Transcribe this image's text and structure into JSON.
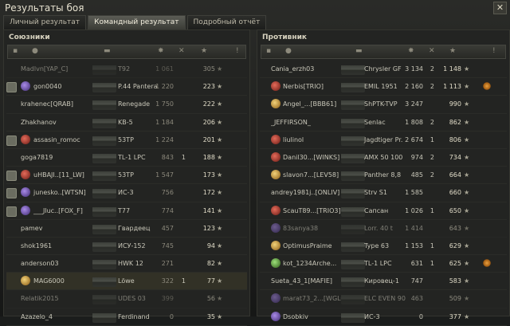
{
  "window": {
    "title": "Результаты боя",
    "close_label": "✕"
  },
  "tabs": [
    {
      "label": "Личный результат"
    },
    {
      "label": "Командный результат"
    },
    {
      "label": "Подробный отчёт"
    }
  ],
  "allies": {
    "header": "Союзники",
    "rows": [
      {
        "name": "Madlvn[YAP_C]",
        "tank": "T92",
        "damage": "1 061",
        "frags": "",
        "xp": "305",
        "dead": true
      },
      {
        "name": "gon0040",
        "tank": "P.44 Pantera",
        "damage": "1 220",
        "frags": "",
        "xp": "223",
        "dead": false
      },
      {
        "name": "krahenec[QRAB]",
        "tank": "Renegade",
        "damage": "1 750",
        "frags": "",
        "xp": "222",
        "dead": false
      },
      {
        "name": "Zhakhanov",
        "tank": "KB-5",
        "damage": "1 184",
        "frags": "",
        "xp": "206",
        "dead": false
      },
      {
        "name": "assasin_romoc",
        "tank": "53TP",
        "damage": "1 224",
        "frags": "",
        "xp": "201",
        "dead": false
      },
      {
        "name": "goga7819",
        "tank": "TL-1 LPC",
        "damage": "843",
        "frags": "1",
        "xp": "188",
        "dead": false
      },
      {
        "name": "uHBAJI..[11_LW]",
        "tank": "53TP",
        "damage": "1 547",
        "frags": "",
        "xp": "173",
        "dead": false
      },
      {
        "name": "junesko..[WTSN]",
        "tank": "ИС-3",
        "damage": "756",
        "frags": "",
        "xp": "172",
        "dead": false
      },
      {
        "name": "___Jluc..[FOX_F]",
        "tank": "T77",
        "damage": "774",
        "frags": "",
        "xp": "141",
        "dead": false
      },
      {
        "name": "pamev",
        "tank": "Гвардеец",
        "damage": "457",
        "frags": "",
        "xp": "123",
        "dead": false
      },
      {
        "name": "shok1961",
        "tank": "ИСУ-152",
        "damage": "745",
        "frags": "",
        "xp": "94",
        "dead": false
      },
      {
        "name": "anderson03",
        "tank": "HWK 12",
        "damage": "271",
        "frags": "",
        "xp": "82",
        "dead": false
      },
      {
        "name": "MAG6000",
        "tank": "Löwe",
        "damage": "322",
        "frags": "1",
        "xp": "77",
        "dead": false
      },
      {
        "name": "Relatik2015",
        "tank": "UDES 03",
        "damage": "399",
        "frags": "",
        "xp": "56",
        "dead": true
      },
      {
        "name": "Azazelo_4",
        "tank": "Ferdinand",
        "damage": "0",
        "frags": "",
        "xp": "35",
        "dead": false
      }
    ]
  },
  "enemies": {
    "header": "Противник",
    "rows": [
      {
        "name": "Cania_erzh03",
        "tank": "Chrysler GF",
        "damage": "3 134",
        "frags": "2",
        "xp": "1 148",
        "medal": false,
        "dead": false
      },
      {
        "name": "Nerbis[TRIO]",
        "tank": "EMIL 1951",
        "damage": "2 160",
        "frags": "2",
        "xp": "1 113",
        "medal": true,
        "dead": false
      },
      {
        "name": "Angel_...[BBB61]",
        "tank": "ShPTK-TVP",
        "damage": "3 247",
        "frags": "",
        "xp": "990",
        "medal": false,
        "dead": false
      },
      {
        "name": "_JEFFIRSON_",
        "tank": "Senlac",
        "damage": "1 808",
        "frags": "2",
        "xp": "862",
        "medal": false,
        "dead": false
      },
      {
        "name": "liulinol",
        "tank": "Jagdtiger Pr.",
        "damage": "2 674",
        "frags": "1",
        "xp": "806",
        "medal": false,
        "dead": false
      },
      {
        "name": "Danil30...[WINKS]",
        "tank": "AMX 50 100",
        "damage": "974",
        "frags": "2",
        "xp": "734",
        "medal": false,
        "dead": false
      },
      {
        "name": "slavon7...[LEV58]",
        "tank": "Panther 8,8",
        "damage": "485",
        "frags": "2",
        "xp": "664",
        "medal": false,
        "dead": false
      },
      {
        "name": "andrey1981j..[ONLIV]",
        "tank": "Strv S1",
        "damage": "1 585",
        "frags": "",
        "xp": "660",
        "medal": false,
        "dead": false
      },
      {
        "name": "ScauT89...[TRIO3]",
        "tank": "Сапсан",
        "damage": "1 026",
        "frags": "1",
        "xp": "650",
        "medal": false,
        "dead": false
      },
      {
        "name": "83sanya38",
        "tank": "Lorr. 40 t",
        "damage": "1 414",
        "frags": "",
        "xp": "643",
        "medal": false,
        "dead": true
      },
      {
        "name": "OptimusPraime",
        "tank": "Type 63",
        "damage": "1 153",
        "frags": "1",
        "xp": "629",
        "medal": false,
        "dead": false
      },
      {
        "name": "kot_1234Arche...",
        "tank": "TL-1 LPC",
        "damage": "631",
        "frags": "1",
        "xp": "625",
        "medal": true,
        "dead": false
      },
      {
        "name": "Sueta_43_1[MAFIE]",
        "tank": "Кировец-1",
        "damage": "747",
        "frags": "",
        "xp": "583",
        "medal": false,
        "dead": false
      },
      {
        "name": "marat73_2...[WGLOM]",
        "tank": "ELC EVEN 90",
        "damage": "463",
        "frags": "",
        "xp": "509",
        "medal": false,
        "dead": true
      },
      {
        "name": "Dsobkiv",
        "tank": "ИС-3",
        "damage": "0",
        "frags": "",
        "xp": "377",
        "medal": false,
        "dead": false
      }
    ]
  },
  "star_glyph": "★"
}
